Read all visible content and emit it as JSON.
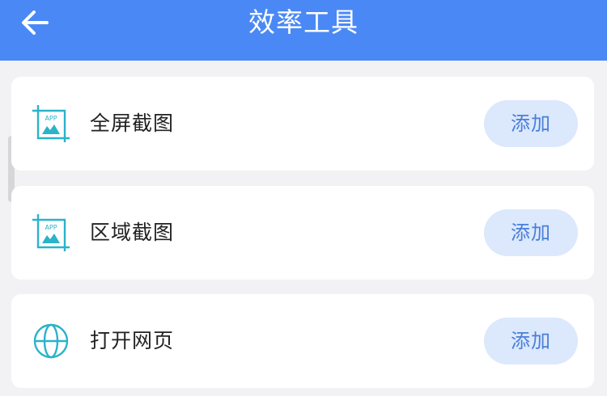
{
  "header": {
    "title": "效率工具",
    "back_icon": "arrow-left-icon",
    "background": "#4a89f5"
  },
  "tools": [
    {
      "label": "全屏截图",
      "icon": "app-screenshot-icon",
      "action_label": "添加"
    },
    {
      "label": "区域截图",
      "icon": "app-screenshot-icon",
      "action_label": "添加"
    },
    {
      "label": "打开网页",
      "icon": "globe-icon",
      "action_label": "添加"
    }
  ],
  "colors": {
    "accent": "#4a89f5",
    "icon": "#2ab3c9",
    "button_bg": "#dce8fc",
    "button_text": "#4a7fd8"
  }
}
